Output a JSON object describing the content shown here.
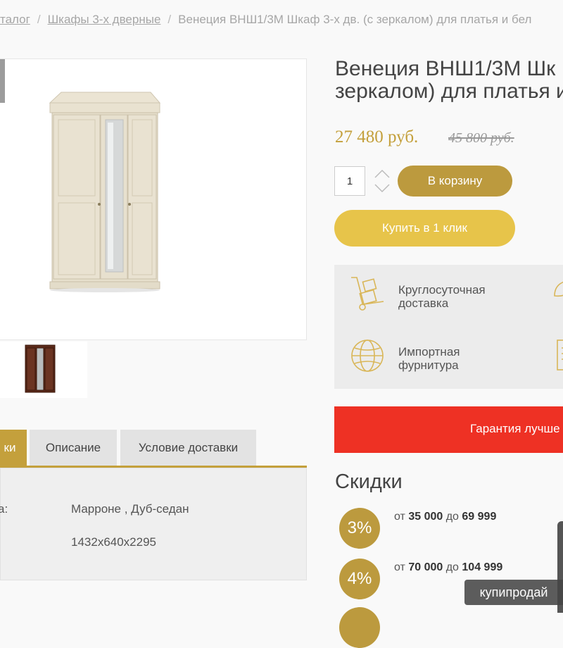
{
  "breadcrumb": {
    "catalog": "талог",
    "category": "Шкафы 3-х дверные",
    "current": "Венеция ВНШ1/3М Шкаф 3-х дв. (с зеркалом) для платья и бел"
  },
  "product": {
    "title_line1": "Венеция ВНШ1/3М Шк",
    "title_line2": "зеркалом) для платья и",
    "price": "27 480 руб.",
    "old_price": "45 800 руб.",
    "quantity": "1",
    "add_to_cart": "В корзину",
    "buy_one_click": "Купить в 1 клик"
  },
  "features": [
    {
      "icon": "delivery-cart-icon",
      "line1": "Круглосуточная",
      "line2": "доставка"
    },
    {
      "icon": "globe-icon",
      "line1": "Импортная",
      "line2": "фурнитура"
    }
  ],
  "guarantee": "Гарантия лучше",
  "tabs": [
    {
      "label": "ки",
      "active": true
    },
    {
      "label": "Описание",
      "active": false
    },
    {
      "label": "Условие доставки",
      "active": false
    }
  ],
  "properties": {
    "label": "а:",
    "value1": "Марроне , Дуб-седан",
    "value2": "1432x640x2295"
  },
  "discounts": {
    "title": "Скидки",
    "items": [
      {
        "percent": "3%",
        "from_word": "от",
        "from": "35 000",
        "to_word": "до",
        "to": "69 999"
      },
      {
        "percent": "4%",
        "from_word": "от",
        "from": "70 000",
        "to_word": "до",
        "to": "104 999"
      }
    ]
  },
  "watermark": "купипродай",
  "colors": {
    "gold": "#c4a03c",
    "gold_light": "#e7c44a",
    "red": "#ee3124"
  }
}
